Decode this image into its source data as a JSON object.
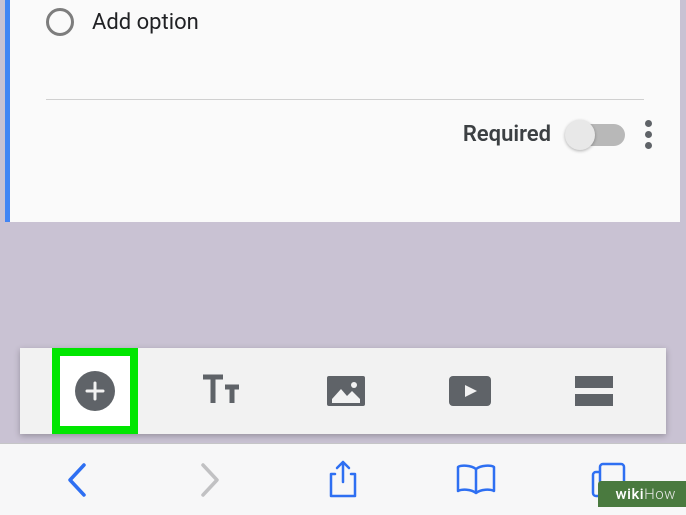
{
  "form": {
    "add_option_label": "Add option",
    "required_label": "Required"
  },
  "toolbar": {
    "items": [
      {
        "name": "add-question",
        "icon": "plus-circle"
      },
      {
        "name": "add-title",
        "icon": "text-t"
      },
      {
        "name": "add-image",
        "icon": "image"
      },
      {
        "name": "add-video",
        "icon": "video"
      },
      {
        "name": "add-section",
        "icon": "section"
      }
    ],
    "highlighted_index": 0
  },
  "browser": {
    "items": [
      {
        "name": "back",
        "enabled": true
      },
      {
        "name": "forward",
        "enabled": false
      },
      {
        "name": "share",
        "enabled": true
      },
      {
        "name": "bookmarks",
        "enabled": true
      },
      {
        "name": "tabs",
        "enabled": true
      }
    ]
  },
  "watermark": {
    "prefix": "wiki",
    "suffix": "How"
  },
  "colors": {
    "accent": "#4285f4",
    "highlight": "#00e600",
    "icon": "#5f6368",
    "safari_blue": "#2e6ff2"
  }
}
